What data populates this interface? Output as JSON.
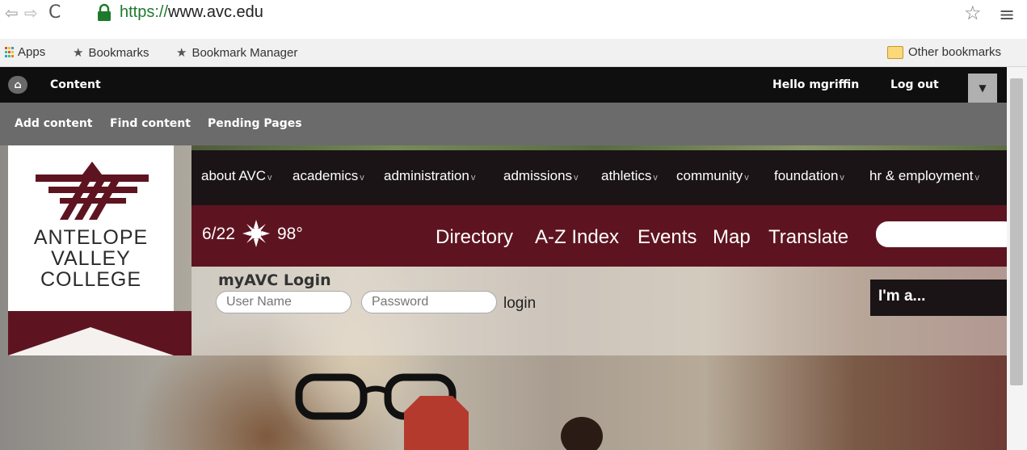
{
  "browser": {
    "url_protocol": "https://",
    "url_domain": "www.avc.edu",
    "bookmarks": [
      {
        "label": "Apps"
      },
      {
        "label": "Bookmarks"
      },
      {
        "label": "Bookmark Manager"
      }
    ],
    "other_bookmarks": "Other bookmarks"
  },
  "admin": {
    "content": "Content",
    "hello_prefix": "Hello ",
    "username": "mgriffin",
    "logout": "Log out",
    "shortcuts": [
      "Add content",
      "Find content",
      "Pending Pages"
    ]
  },
  "logo": {
    "line1": "ANTELOPE",
    "line2": "VALLEY",
    "line3": "COLLEGE"
  },
  "nav": [
    {
      "label": "about AVC"
    },
    {
      "label": "academics"
    },
    {
      "label": "administration"
    },
    {
      "label": "admissions"
    },
    {
      "label": "athletics"
    },
    {
      "label": "community"
    },
    {
      "label": "foundation"
    },
    {
      "label": "hr & employment"
    }
  ],
  "quick": {
    "date": "6/22",
    "temp": "98°",
    "links": [
      "Directory",
      "A-Z Index",
      "Events",
      "Map",
      "Translate"
    ]
  },
  "login": {
    "title": "myAVC Login",
    "username_placeholder": "User Name",
    "password_placeholder": "Password",
    "login_link": "login"
  },
  "im_a": "I'm a...",
  "colors": {
    "maroon": "#5e1420",
    "admin_black": "#0f0f0f",
    "admin_gray": "#6b6b6b",
    "url_green": "#1d7a2c"
  }
}
